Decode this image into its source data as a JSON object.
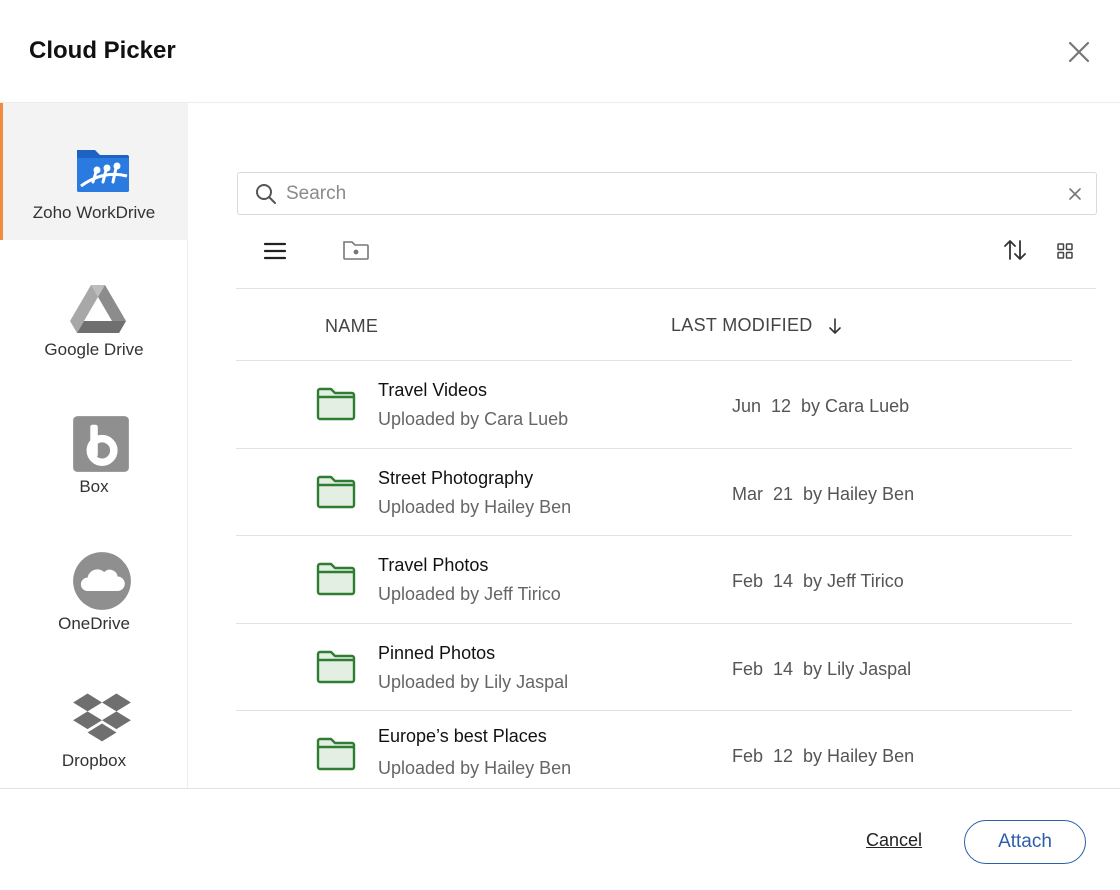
{
  "dialog": {
    "title": "Cloud Picker"
  },
  "providers": [
    {
      "label": "Zoho WorkDrive",
      "icon": "zoho-workdrive-icon",
      "active": true
    },
    {
      "label": "Google Drive",
      "icon": "google-drive-icon",
      "active": false
    },
    {
      "label": "Box",
      "icon": "box-icon",
      "active": false
    },
    {
      "label": "OneDrive",
      "icon": "onedrive-icon",
      "active": false
    },
    {
      "label": "Dropbox",
      "icon": "dropbox-icon",
      "active": false
    }
  ],
  "search": {
    "placeholder": "Search",
    "value": ""
  },
  "table": {
    "columns": {
      "name": "NAME",
      "modified": "LAST MODIFIED"
    },
    "rows": [
      {
        "name": "Travel Videos",
        "uploaded": "Uploaded by Cara Lueb",
        "modified": "Jun  12  by Cara Lueb"
      },
      {
        "name": "Street Photography",
        "uploaded": "Uploaded by Hailey Ben",
        "modified": "Mar  21  by Hailey Ben"
      },
      {
        "name": "Travel Photos",
        "uploaded": "Uploaded by Jeff Tirico",
        "modified": "Feb  14  by Jeff Tirico"
      },
      {
        "name": "Pinned Photos",
        "uploaded": "Uploaded by Lily Jaspal",
        "modified": "Feb  14  by Lily Jaspal"
      },
      {
        "name": "Europe’s best Places",
        "uploaded": "Uploaded by Hailey Ben",
        "modified": "Feb  12  by Hailey Ben"
      }
    ]
  },
  "footer": {
    "cancel_label": "Cancel",
    "attach_label": "Attach"
  },
  "colors": {
    "accent": "#f08b3f",
    "primary": "#2c5eaa",
    "folder": "#2e7d32",
    "folder_fill": "#e4efe4"
  }
}
